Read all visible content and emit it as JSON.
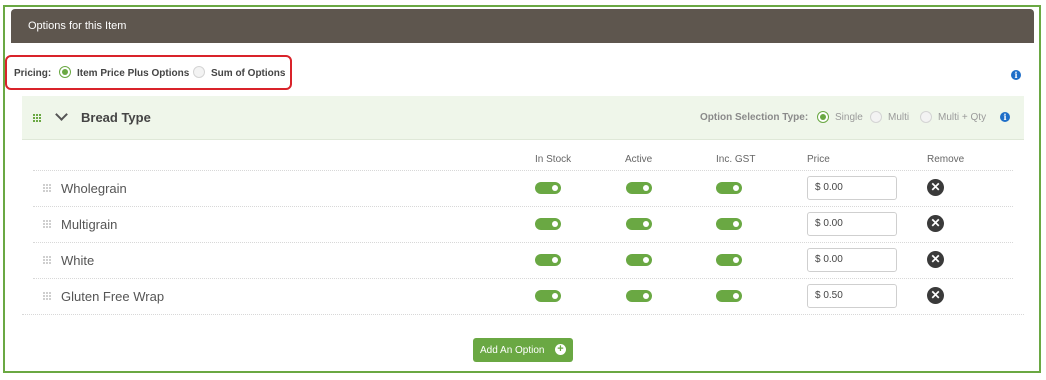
{
  "panel": {
    "title": "Options for this Item"
  },
  "pricing": {
    "label": "Pricing:",
    "options": [
      {
        "label": "Item Price Plus Options",
        "selected": true
      },
      {
        "label": "Sum of Options",
        "selected": false
      }
    ]
  },
  "group": {
    "title": "Bread Type",
    "selection_type_label": "Option Selection Type:",
    "selection_options": [
      {
        "label": "Single",
        "selected": true
      },
      {
        "label": "Multi",
        "selected": false
      },
      {
        "label": "Multi + Qty",
        "selected": false
      }
    ]
  },
  "table": {
    "headers": [
      "In Stock",
      "Active",
      "Inc. GST",
      "Price",
      "Remove"
    ],
    "rows": [
      {
        "name": "Wholegrain",
        "in_stock": true,
        "active": true,
        "inc_gst": true,
        "price": "$ 0.00"
      },
      {
        "name": "Multigrain",
        "in_stock": true,
        "active": true,
        "inc_gst": true,
        "price": "$ 0.00"
      },
      {
        "name": "White",
        "in_stock": true,
        "active": true,
        "inc_gst": true,
        "price": "$ 0.00"
      },
      {
        "name": "Gluten Free Wrap",
        "in_stock": true,
        "active": true,
        "inc_gst": true,
        "price": "$ 0.50"
      }
    ]
  },
  "add_button": {
    "label": "Add An Option"
  },
  "icons": {
    "info": "info-icon",
    "drag": "grid-drag-icon",
    "chevron": "chevron-down-icon",
    "remove": "close-circle-icon",
    "add": "plus-circle-icon"
  },
  "colors": {
    "accent_green": "#6aa843",
    "header_bg": "#5e564e",
    "highlight_red": "#d9232a",
    "info_blue": "#1e6ec8"
  }
}
